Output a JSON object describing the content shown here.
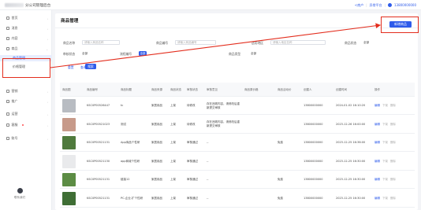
{
  "app": {
    "title": "分公司管理后台",
    "links": [
      "<商户",
      "异常平台"
    ],
    "phone": "13800000000"
  },
  "sidebar": {
    "items": [
      {
        "label": "首页"
      },
      {
        "label": "消息"
      },
      {
        "label": "内容"
      },
      {
        "label": "商品"
      },
      {
        "label": "商品管理"
      },
      {
        "label": "价格管理"
      },
      {
        "label": "营销"
      },
      {
        "label": "推广"
      },
      {
        "label": "运营"
      },
      {
        "label": "客服"
      },
      {
        "label": "账号"
      }
    ],
    "bottom_label": "联系我们"
  },
  "page": {
    "title": "商品管理",
    "add_button": "新增商品"
  },
  "filters": {
    "name_label": "商品名称",
    "name_placeholder": "请输入商品名称",
    "code_label": "商品编号",
    "code_placeholder": "请输入商品编号",
    "place_label": "适用地区",
    "place_placeholder": "请输入地区名称",
    "status_label": "商品状态",
    "status_value": "全部",
    "audit_label": "审核状态",
    "audit_value": "全部",
    "flow_label": "流程编号",
    "flow_tag": "全部",
    "type_label": "商品类型",
    "type_value": "全部",
    "reset_label": "重置",
    "search_label": "查询",
    "search_button": "搜索"
  },
  "table": {
    "headers": [
      "商品图",
      "商品编号",
      "商品标题",
      "商品来源",
      "商品状态",
      "审核状态",
      "审核意见",
      "商品原价格",
      "商品活动价",
      "创建人",
      "创建时间",
      "操作"
    ],
    "rows": [
      {
        "code": "KSC0P00526447",
        "title": "tc",
        "source": "家居用品",
        "status": "上架",
        "audit": "待修改",
        "opinion": "存在违规内容，请修改后重新提交审核",
        "price": "",
        "promo": "",
        "creator": "13800000000",
        "time": "2024-01-02 16:10:20",
        "actions": [
          "编辑",
          "下架",
          "删除"
        ],
        "color": "#b8bcc2"
      },
      {
        "code": "KSC0P00521023",
        "title": "测试",
        "source": "家居用品",
        "status": "上架",
        "audit": "待修改",
        "opinion": "存在违规内容，请修改后重新提交审核",
        "price": "",
        "promo": "",
        "creator": "13800000000",
        "time": "2023-12-26 16:00:00",
        "actions": [
          "编辑",
          "下架",
          "删除"
        ],
        "color": "#c79a8a"
      },
      {
        "code": "KSC0P00521131",
        "title": "App商品个性研",
        "source": "家居用品",
        "status": "上架",
        "audit": "审核通过",
        "opinion": "--",
        "price": "",
        "promo": "免费",
        "creator": "13800000000",
        "time": "2023-12-25 16:36:00",
        "actions": [
          "编辑",
          "下架",
          "删除"
        ],
        "color": "#4f7a3d"
      },
      {
        "code": "KSC0P00521130",
        "title": "app商城个性研",
        "source": "家居用品",
        "status": "上架",
        "audit": "审核通过",
        "opinion": "--",
        "price": "",
        "promo": "",
        "creator": "13800000000",
        "time": "2023-12-25 16:30:00",
        "actions": [
          "编辑",
          "下架",
          "删除"
        ],
        "color": "#e9eaec"
      },
      {
        "code": "KSC0P00521131",
        "title": "链接12",
        "source": "家居用品",
        "status": "上架",
        "audit": "审核通过",
        "opinion": "--",
        "price": "",
        "promo": "免费",
        "creator": "13800000000",
        "time": "2023-12-25 16:30:00",
        "actions": [
          "编辑",
          "下架",
          "删除"
        ],
        "color": "#5c8c44"
      },
      {
        "code": "KSC0P00521131",
        "title": "PC-企业-扩个性研",
        "source": "家居用品",
        "status": "上架",
        "audit": "审核通过",
        "opinion": "--",
        "price": "",
        "promo": "免费",
        "creator": "13800000000",
        "time": "2023-12-25 16:30:00",
        "actions": [
          "编辑",
          "下架",
          "删除"
        ],
        "color": "#3f6e35"
      }
    ]
  },
  "colors": {
    "primary": "#2e5bea",
    "annotation": "#e32d1d",
    "active_bg": "#e8eefe"
  }
}
